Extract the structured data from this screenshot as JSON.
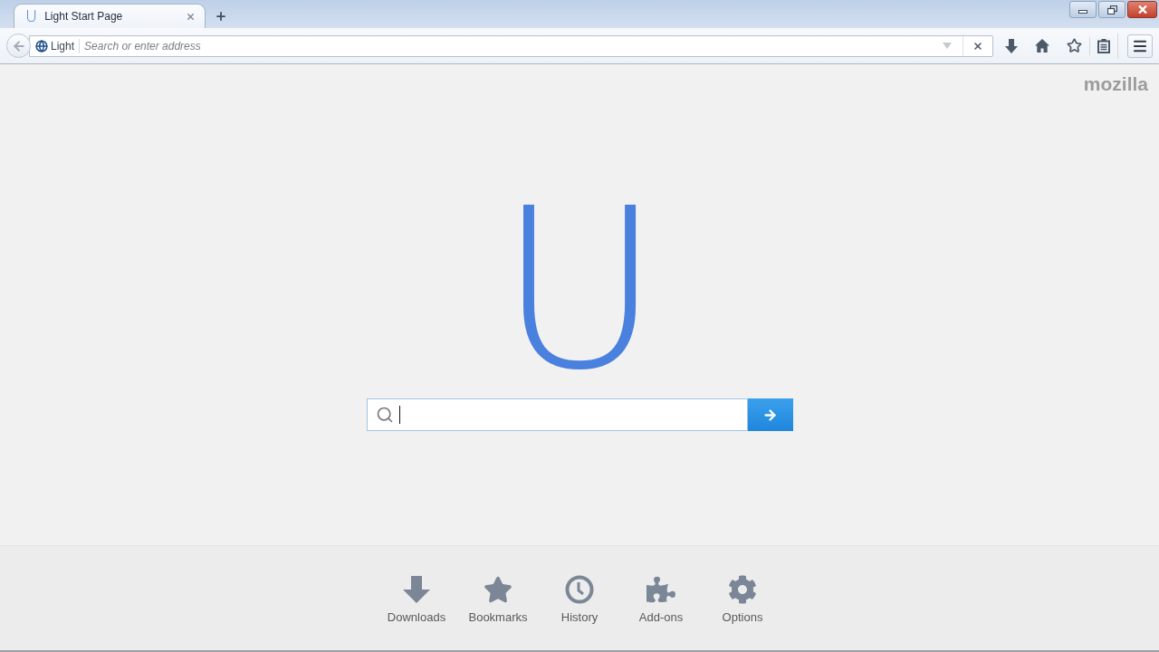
{
  "tabs": [
    {
      "favicon": "U",
      "title": "Light Start Page",
      "selected": true
    }
  ],
  "toolbar": {
    "identity": "Light",
    "address": {
      "placeholder": "Search or enter address"
    }
  },
  "page": {
    "brand": "mozilla",
    "logo": "U",
    "search": {
      "focused": true
    }
  },
  "launcher": [
    {
      "kind": "downloads",
      "label": "Downloads"
    },
    {
      "kind": "bookmarks",
      "label": "Bookmarks"
    },
    {
      "kind": "history",
      "label": "History"
    },
    {
      "kind": "addons",
      "label": "Add-ons"
    },
    {
      "kind": "options",
      "label": "Options"
    }
  ]
}
